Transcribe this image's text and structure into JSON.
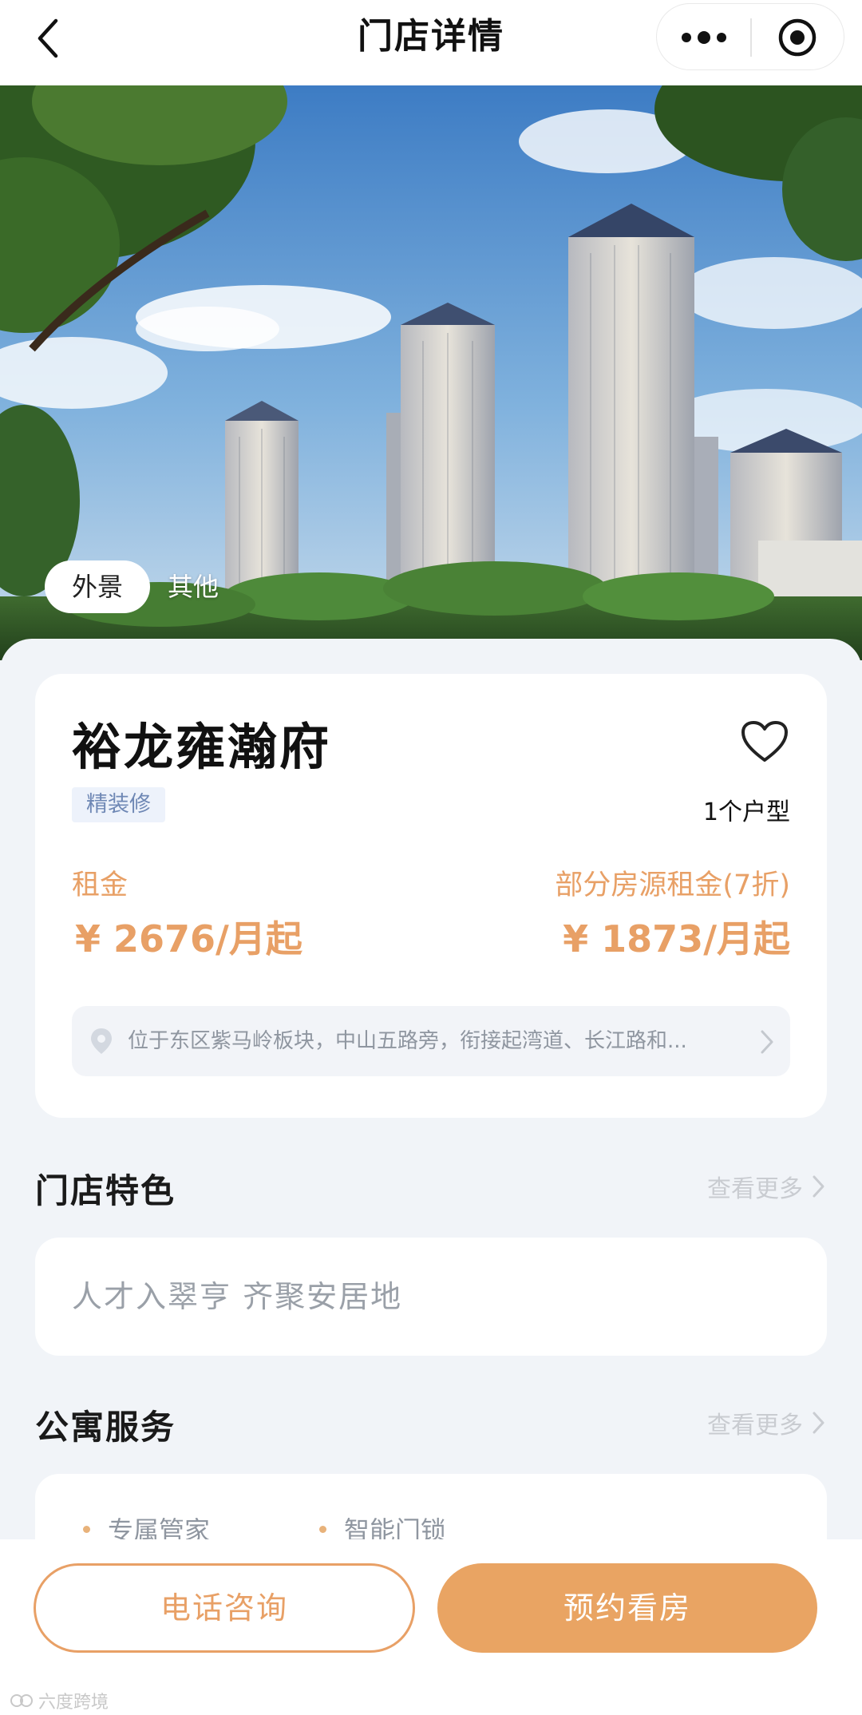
{
  "nav": {
    "title": "门店详情",
    "back_icon": "chevron-left-icon",
    "more_icon": "more-dots-icon",
    "target_icon": "target-icon"
  },
  "hero": {
    "tabs": [
      {
        "label": "外景",
        "active": true
      },
      {
        "label": "其他",
        "active": false
      }
    ]
  },
  "property": {
    "name": "裕龙雍瀚府",
    "tag": "精装修",
    "unit_count": "1个户型",
    "favorite_icon": "heart-outline-icon",
    "rent_label": "租金",
    "rent_value": "¥ 2676/月起",
    "discount_label": "部分房源租金(7折)",
    "discount_value": "¥ 1873/月起",
    "address": "位于东区紫马岭板块，中山五路旁，衔接起湾道、长江路和...",
    "address_icon": "location-pin-icon"
  },
  "features": {
    "title": "门店特色",
    "more": "查看更多",
    "text": "人才入翠亨 齐聚安居地"
  },
  "services": {
    "title": "公寓服务",
    "more": "查看更多",
    "items": [
      "专属管家",
      "智能门锁"
    ]
  },
  "actions": {
    "call_label": "电话咨询",
    "book_label": "预约看房"
  },
  "watermark": "六度跨境",
  "colors": {
    "accent": "#e8a066",
    "accent_fill": "#e9a463",
    "tag_bg": "#edf2fb",
    "tag_text": "#6f88b5",
    "page_bg": "#f1f4f8"
  }
}
